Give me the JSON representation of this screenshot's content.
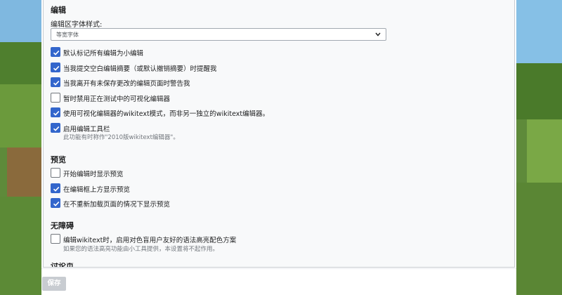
{
  "colors": {
    "accent": "#3366cc",
    "panel_bg": "#f8f9fa",
    "border": "#c8ccd1",
    "help_text": "#72777d"
  },
  "sections": [
    {
      "title": "编辑",
      "font_label": "编辑区字体样式:",
      "font_select_value": "等宽字体",
      "options": [
        {
          "label": "默认标记所有编辑为小编辑",
          "checked": true
        },
        {
          "label": "当我提交空白编辑摘要（或默认撤销摘要）时提醒我",
          "checked": true
        },
        {
          "label": "当我离开有未保存更改的编辑页面时警告我",
          "checked": true
        },
        {
          "label": "暂时禁用正在测试中的可视化编辑器",
          "checked": false
        },
        {
          "label": "使用可视化编辑器的wikitext模式，而非另一独立的wikitext编辑器。",
          "checked": true
        },
        {
          "label": "启用编辑工具栏",
          "checked": true,
          "help": "此功能有时称作\"2010版wikitext编辑器\"。"
        }
      ]
    },
    {
      "title": "预览",
      "options": [
        {
          "label": "开始编辑时显示预览",
          "checked": false
        },
        {
          "label": "在编辑框上方显示预览",
          "checked": true
        },
        {
          "label": "在不重新加载页面的情况下显示预览",
          "checked": true
        }
      ]
    },
    {
      "title": "无障碍",
      "options": [
        {
          "label": "编辑wikitext时，启用对色盲用户友好的语法高亮配色方案",
          "checked": false,
          "help": "如果您的语法高亮功能由小工具提供，本设置将不起作用。"
        }
      ]
    }
  ],
  "next_section_title": "讨论页",
  "footer": {
    "save_label": "保存"
  }
}
